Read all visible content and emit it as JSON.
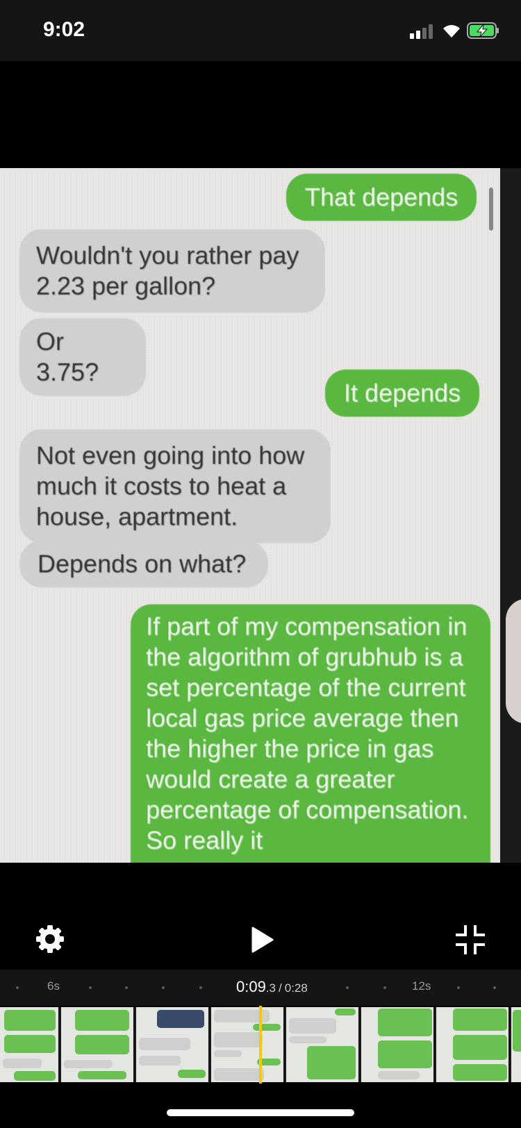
{
  "status_bar": {
    "time": "9:02",
    "icons": [
      "signal-icon",
      "wifi-icon",
      "battery-charging-icon"
    ]
  },
  "video": {
    "messages": [
      {
        "side": "out",
        "text": "That depends"
      },
      {
        "side": "in",
        "text": "Wouldn't you rather pay 2.23 per gallon?"
      },
      {
        "side": "in",
        "text": "Or 3.75?"
      },
      {
        "side": "out",
        "text": "It depends"
      },
      {
        "side": "in",
        "text": "Not even going into how much it costs to heat a house, apartment."
      },
      {
        "side": "in",
        "text": "Depends on what?"
      },
      {
        "side": "out",
        "text": "If part of my compensation in the algorithm of grubhub is a set percentage of the current local gas price average then the higher the price in gas would create a greater percentage of compensation. So really it"
      }
    ],
    "colors": {
      "outgoing": "#5ab840",
      "incoming": "#d2d0ce"
    }
  },
  "controls": {
    "settings_icon": "gear-icon",
    "play_icon": "play-icon",
    "exit_fullscreen_icon": "exit-fullscreen-icon"
  },
  "timeline": {
    "current": "0:09",
    "current_fraction": ".3",
    "separator": "/",
    "total": "0:28",
    "marker_left": "6s",
    "marker_right": "12s",
    "accent": "#f5c518"
  }
}
